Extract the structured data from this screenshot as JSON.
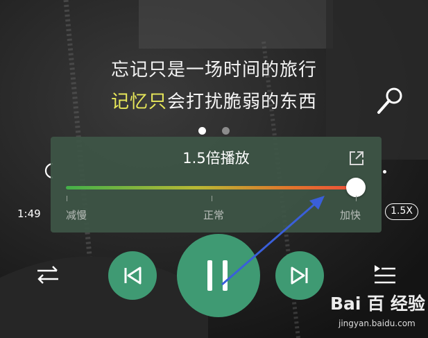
{
  "lyrics": {
    "line1": "忘记只是一场时间的旅行",
    "line2_highlight": "记忆只",
    "line2_rest": "会打扰脆弱的东西"
  },
  "page_dots": {
    "count": 2,
    "active": 1
  },
  "speed_panel": {
    "title": "1.5倍播放",
    "slider_value": 1.0,
    "label_slow": "减慢",
    "label_normal": "正常",
    "label_fast": "加快"
  },
  "player": {
    "current_time": "1:49",
    "speed_badge": "1.5X"
  },
  "icons": {
    "mic": "microphone-icon",
    "share": "external-share-icon",
    "shuffle": "shuffle-icon",
    "prev": "skip-previous-icon",
    "pause": "pause-icon",
    "next": "skip-next-icon",
    "playlist": "playlist-icon"
  },
  "colors": {
    "accent_green": "#3f9a73",
    "lyric_highlight": "#e8e85a",
    "annotation_arrow": "#3a5fd9"
  },
  "watermark": {
    "brand": "Bai 百 经验",
    "url": "jingyan.baidu.com"
  }
}
